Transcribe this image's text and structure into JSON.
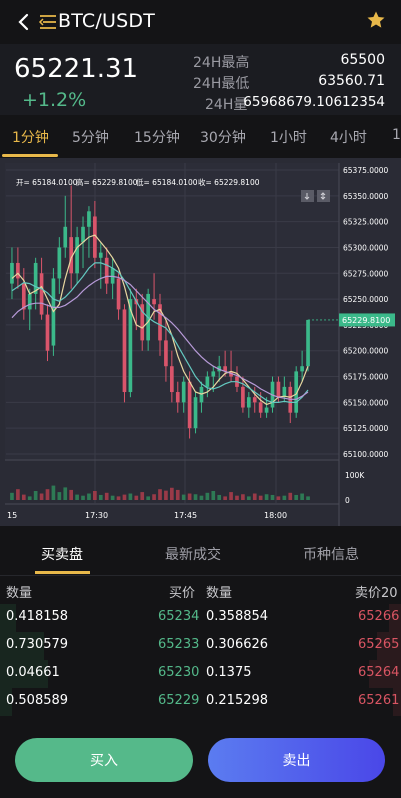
{
  "header": {
    "pair": "BTC/USDT"
  },
  "ticker": {
    "last_price": "65221.31",
    "change": "+1.2%",
    "stats": [
      {
        "label": "24H最高",
        "value": "65500"
      },
      {
        "label": "24H最低",
        "value": "63560.71"
      },
      {
        "label": "24H量",
        "value": "65968679.10612354"
      }
    ]
  },
  "intervals": [
    "1分钟",
    "5分钟",
    "15分钟",
    "30分钟",
    "1小时",
    "4小时",
    "1"
  ],
  "active_interval": "1分钟",
  "chart": {
    "ohlc_info": {
      "open": "开= 65184.0100",
      "high": "高= 65229.8100",
      "low": "低= 65184.0100",
      "close": "收= 65229.8100"
    },
    "current_price_tag": "65229.8100",
    "price_ticks": [
      "65375.0000",
      "65350.0000",
      "65325.0000",
      "65300.0000",
      "65275.0000",
      "65250.0000",
      "65225.0000",
      "65200.0000",
      "65175.0000",
      "65150.0000",
      "65125.0000",
      "65100.0000"
    ],
    "volume_ticks": [
      "100K",
      "0"
    ],
    "time_ticks": [
      "15",
      "17:30",
      "17:45",
      "18:00"
    ],
    "colors": {
      "up": "#3bb98a",
      "down": "#d9556b",
      "ma1": "#e8d7a0",
      "ma2": "#63c8c0",
      "ma3": "#b79ad8"
    }
  },
  "chart_data": {
    "type": "candlestick",
    "ylim": [
      65100,
      65375
    ],
    "candles": [
      {
        "o": 65265,
        "h": 65300,
        "l": 65250,
        "c": 65285
      },
      {
        "o": 65285,
        "h": 65300,
        "l": 65260,
        "c": 65270
      },
      {
        "o": 65265,
        "h": 65280,
        "l": 65230,
        "c": 65240
      },
      {
        "o": 65240,
        "h": 65260,
        "l": 65220,
        "c": 65255
      },
      {
        "o": 65255,
        "h": 65290,
        "l": 65240,
        "c": 65285
      },
      {
        "o": 65275,
        "h": 65290,
        "l": 65230,
        "c": 65235
      },
      {
        "o": 65235,
        "h": 65245,
        "l": 65190,
        "c": 65200
      },
      {
        "o": 65205,
        "h": 65280,
        "l": 65195,
        "c": 65270
      },
      {
        "o": 65270,
        "h": 65310,
        "l": 65255,
        "c": 65300
      },
      {
        "o": 65300,
        "h": 65350,
        "l": 65290,
        "c": 65320
      },
      {
        "o": 65310,
        "h": 65360,
        "l": 65260,
        "c": 65275
      },
      {
        "o": 65275,
        "h": 65320,
        "l": 65265,
        "c": 65310
      },
      {
        "o": 65305,
        "h": 65330,
        "l": 65280,
        "c": 65320
      },
      {
        "o": 65320,
        "h": 65340,
        "l": 65290,
        "c": 65335
      },
      {
        "o": 65330,
        "h": 65345,
        "l": 65280,
        "c": 65290
      },
      {
        "o": 65290,
        "h": 65305,
        "l": 65260,
        "c": 65295
      },
      {
        "o": 65290,
        "h": 65300,
        "l": 65255,
        "c": 65265
      },
      {
        "o": 65265,
        "h": 65290,
        "l": 65250,
        "c": 65280
      },
      {
        "o": 65270,
        "h": 65275,
        "l": 65230,
        "c": 65240
      },
      {
        "o": 65240,
        "h": 65245,
        "l": 65150,
        "c": 65160
      },
      {
        "o": 65160,
        "h": 65260,
        "l": 65155,
        "c": 65250
      },
      {
        "o": 65250,
        "h": 65260,
        "l": 65220,
        "c": 65245
      },
      {
        "o": 65245,
        "h": 65255,
        "l": 65200,
        "c": 65210
      },
      {
        "o": 65210,
        "h": 65260,
        "l": 65200,
        "c": 65255
      },
      {
        "o": 65250,
        "h": 65275,
        "l": 65230,
        "c": 65245
      },
      {
        "o": 65245,
        "h": 65255,
        "l": 65195,
        "c": 65210
      },
      {
        "o": 65210,
        "h": 65230,
        "l": 65170,
        "c": 65185
      },
      {
        "o": 65185,
        "h": 65200,
        "l": 65150,
        "c": 65160
      },
      {
        "o": 65160,
        "h": 65170,
        "l": 65140,
        "c": 65150
      },
      {
        "o": 65150,
        "h": 65175,
        "l": 65140,
        "c": 65170
      },
      {
        "o": 65170,
        "h": 65180,
        "l": 65115,
        "c": 65125
      },
      {
        "o": 65125,
        "h": 65160,
        "l": 65120,
        "c": 65155
      },
      {
        "o": 65150,
        "h": 65170,
        "l": 65140,
        "c": 65165
      },
      {
        "o": 65165,
        "h": 65180,
        "l": 65155,
        "c": 65175
      },
      {
        "o": 65175,
        "h": 65185,
        "l": 65160,
        "c": 65180
      },
      {
        "o": 65180,
        "h": 65195,
        "l": 65170,
        "c": 65185
      },
      {
        "o": 65185,
        "h": 65200,
        "l": 65175,
        "c": 65180
      },
      {
        "o": 65180,
        "h": 65200,
        "l": 65170,
        "c": 65175
      },
      {
        "o": 65175,
        "h": 65185,
        "l": 65160,
        "c": 65165
      },
      {
        "o": 65165,
        "h": 65175,
        "l": 65140,
        "c": 65145
      },
      {
        "o": 65145,
        "h": 65160,
        "l": 65135,
        "c": 65155
      },
      {
        "o": 65155,
        "h": 65165,
        "l": 65140,
        "c": 65150
      },
      {
        "o": 65150,
        "h": 65160,
        "l": 65135,
        "c": 65140
      },
      {
        "o": 65140,
        "h": 65155,
        "l": 65135,
        "c": 65145
      },
      {
        "o": 65145,
        "h": 65175,
        "l": 65140,
        "c": 65170
      },
      {
        "o": 65170,
        "h": 65175,
        "l": 65150,
        "c": 65155
      },
      {
        "o": 65155,
        "h": 65175,
        "l": 65150,
        "c": 65165
      },
      {
        "o": 65165,
        "h": 65170,
        "l": 65130,
        "c": 65140
      },
      {
        "o": 65140,
        "h": 65185,
        "l": 65135,
        "c": 65180
      },
      {
        "o": 65180,
        "h": 65200,
        "l": 65170,
        "c": 65185
      },
      {
        "o": 65185,
        "h": 65230,
        "l": 65180,
        "c": 65229.81
      }
    ],
    "ma": [
      {
        "name": "ma1",
        "values": [
          65270,
          65275,
          65268,
          65255,
          65258,
          65262,
          65250,
          65238,
          65245,
          65270,
          65290,
          65300,
          65305,
          65310,
          65312,
          65305,
          65298,
          65290,
          65280,
          65262,
          65240,
          65225,
          65222,
          65228,
          65238,
          65240,
          65230,
          65215,
          65195,
          65180,
          65170,
          65160,
          65158,
          65160,
          65165,
          65172,
          65178,
          65180,
          65178,
          65172,
          65165,
          65158,
          65152,
          65148,
          65150,
          65155,
          65156,
          65155,
          65158,
          65170,
          65185
        ]
      },
      {
        "name": "ma2",
        "values": [
          65258,
          65262,
          65266,
          65265,
          65262,
          65260,
          65256,
          65250,
          65248,
          65252,
          65258,
          65265,
          65272,
          65280,
          65285,
          65285,
          65283,
          65280,
          65276,
          65268,
          65258,
          65248,
          65238,
          65232,
          65228,
          65225,
          65222,
          65215,
          65205,
          65195,
          65185,
          65175,
          65168,
          65164,
          65163,
          65165,
          65168,
          65170,
          65170,
          65168,
          65164,
          65160,
          65156,
          65152,
          65150,
          65150,
          65151,
          65150,
          65150,
          65155,
          65162
        ]
      },
      {
        "name": "ma3",
        "values": [
          65232,
          65238,
          65242,
          65245,
          65246,
          65246,
          65244,
          65242,
          65242,
          65244,
          65248,
          65252,
          65258,
          65263,
          65267,
          65270,
          65272,
          65272,
          65271,
          65268,
          65264,
          65258,
          65252,
          65246,
          65240,
          65236,
          65232,
          65227,
          65221,
          65214,
          65207,
          65200,
          65194,
          65189,
          65185,
          65182,
          65180,
          65178,
          65176,
          65173,
          65170,
          65167,
          65163,
          65160,
          65157,
          65155,
          65154,
          65153,
          65153,
          65156,
          65160
        ]
      }
    ],
    "volume": [
      20,
      30,
      15,
      10,
      25,
      18,
      30,
      40,
      22,
      35,
      28,
      15,
      12,
      18,
      25,
      14,
      20,
      12,
      10,
      15,
      18,
      12,
      22,
      10,
      16,
      30,
      26,
      34,
      28,
      15,
      18,
      16,
      12,
      20,
      25,
      14,
      10,
      22,
      12,
      16,
      10,
      18,
      12,
      16,
      14,
      10,
      12,
      20,
      14,
      18,
      10
    ]
  },
  "order_tabs": [
    "买卖盘",
    "最新成交",
    "币种信息"
  ],
  "order_book": {
    "headers": {
      "qty": "数量",
      "bid": "买价",
      "qty2": "数量",
      "ask": "卖价20"
    },
    "rows": [
      {
        "bid_qty": "0.418158",
        "bid_price": "65234",
        "ask_qty": "0.358854",
        "ask_price": "65266",
        "bid_depth": 0.04,
        "ask_depth": 0.03
      },
      {
        "bid_qty": "0.730579",
        "bid_price": "65233",
        "ask_qty": "0.306626",
        "ask_price": "65265",
        "bid_depth": 0.11,
        "ask_depth": 0.06
      },
      {
        "bid_qty": "0.04661",
        "bid_price": "65230",
        "ask_qty": "0.1375",
        "ask_price": "65264",
        "bid_depth": 0.12,
        "ask_depth": 0.08
      },
      {
        "bid_qty": "0.508589",
        "bid_price": "65229",
        "ask_qty": "0.215298",
        "ask_price": "65261",
        "bid_depth": 0.03,
        "ask_depth": 0.02
      }
    ]
  },
  "actions": {
    "buy": "买入",
    "sell": "卖出"
  }
}
